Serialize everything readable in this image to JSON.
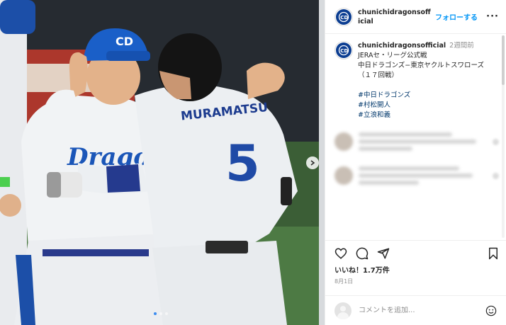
{
  "post": {
    "photo_alt": "",
    "jersey_name": "MURAMATSU",
    "jersey_number": "5",
    "coach_cap_logo": "CD",
    "coach_jersey_text": "Dragons",
    "carousel_dots": 3,
    "active_dot": 0
  },
  "header": {
    "username": "chunichidragonsofficial",
    "follow_label": "フォローする",
    "more_label": "···"
  },
  "caption": {
    "username": "chunichidragonsofficial",
    "time_ago": "2週間前",
    "line1": "JERAセ・リーグ公式戦",
    "line2": "中日ドラゴンズ−東京ヤクルトスワローズ",
    "line3": "（１７回戦）",
    "tags": [
      "#中日ドラゴンズ",
      "#村松開人",
      "#立浪和義"
    ]
  },
  "actions": {
    "like_icon": "heart-icon",
    "comment_icon": "comment-icon",
    "share_icon": "share-icon",
    "save_icon": "bookmark-icon"
  },
  "likes_text": "いいね！1.7万件",
  "date_text": "8月1日",
  "add_comment": {
    "placeholder": "コメントを追加..."
  },
  "colors": {
    "brand_blue": "#0b3d91",
    "link_blue": "#0095f6",
    "tag_color": "#00376b"
  }
}
